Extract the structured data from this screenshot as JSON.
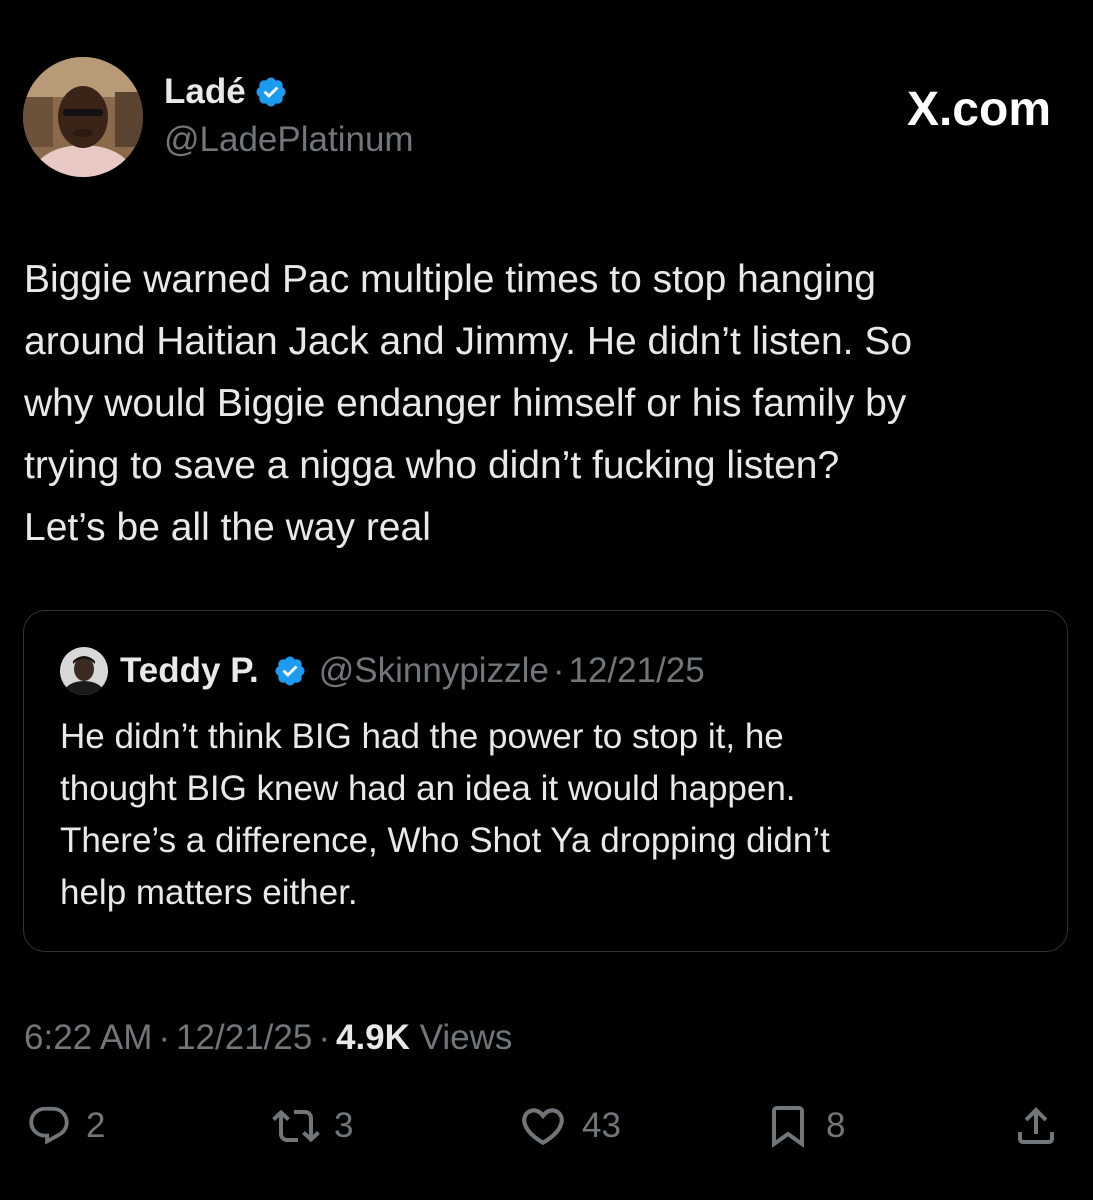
{
  "brand": {
    "site_label": "X.com",
    "verified_color": "#1d9bf0"
  },
  "tweet": {
    "author_name": "Ladé",
    "author_handle": "@LadePlatinum",
    "text": "Biggie warned Pac multiple times to stop hanging\naround Haitian Jack and Jimmy. He didn’t listen. So\nwhy would Biggie endanger himself or his family by\ntrying to save a nigga who didn’t fucking listen?\nLet’s be all the way real",
    "time": "6:22 AM",
    "date": "12/21/25",
    "views_count": "4.9K",
    "views_label": "Views"
  },
  "quoted_tweet": {
    "author_name": "Teddy P.",
    "author_handle": "@Skinnypizzle",
    "date": "12/21/25",
    "text": "He didn’t think BIG had the power to stop it, he\nthought BIG knew had an idea it would happen.\nThere’s a difference, Who Shot Ya dropping didn’t\nhelp matters either."
  },
  "actions": {
    "replies": "2",
    "reposts": "3",
    "likes": "43",
    "bookmarks": "8",
    "icons": [
      "reply-icon",
      "repost-icon",
      "like-icon",
      "bookmark-icon",
      "share-icon"
    ]
  },
  "separator": "·"
}
